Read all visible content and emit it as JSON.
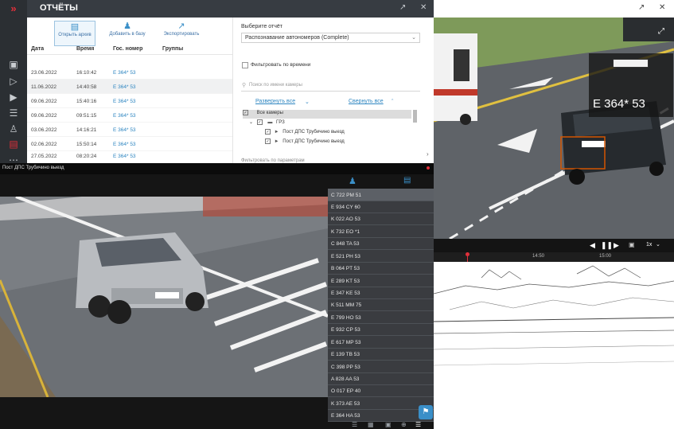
{
  "reports": {
    "title": "ОТЧЁТЫ",
    "toolbar": {
      "open_archive": "Открыть архив",
      "add_to_base": "Добавить в базу",
      "export": "Экспортировать"
    },
    "columns": [
      "Дата",
      "Время",
      "Гос. номер",
      "Группы"
    ],
    "rows": [
      {
        "date": "23.06.2022",
        "time": "16:10:42",
        "plate": "E 364* 53"
      },
      {
        "date": "11.06.2022",
        "time": "14:40:58",
        "plate": "E 364* 53"
      },
      {
        "date": "09.06.2022",
        "time": "15:40:16",
        "plate": "E 364* 53"
      },
      {
        "date": "09.06.2022",
        "time": "09:51:15",
        "plate": "E 364* 53"
      },
      {
        "date": "03.06.2022",
        "time": "14:16:21",
        "plate": "E 364* 53"
      },
      {
        "date": "02.06.2022",
        "time": "15:50:14",
        "plate": "E 364* 53"
      },
      {
        "date": "27.05.2022",
        "time": "08:20:24",
        "plate": "E 364* 53"
      }
    ],
    "select_report_label": "Выберите отчёт",
    "selected_report": "Распознавание автономеров (Complete)",
    "filter_time_label": "Фильтровать по времени",
    "camera_search_placeholder": "Поиск по имени камеры",
    "expand_all": "Развернуть все",
    "collapse_all": "Свернуть все",
    "tree": {
      "all_cameras": "Все камеры",
      "group": "ГРЗ",
      "cam1": "Пост ДПС Трубичино выезд",
      "cam2": "Пост ДПС Трубичино выезд"
    },
    "filter_params": "Фильтровать по параметрам"
  },
  "camera": {
    "name": "Пост ДПС Трубичино выезд",
    "plates": [
      "C 722 PM 51",
      "E 934 CY 60",
      "K 022 AO 53",
      "K 732 EO *1",
      "C 848 TA 53",
      "E 521 PH 53",
      "B 064 PT 53",
      "E 289 KT 53",
      "E 347 KE 53",
      "K 511 MM 75",
      "E 799 HO 53",
      "E 932 CP 53",
      "E 617 MP 53",
      "E 139 TB 53",
      "C 398 PP 53",
      "A 828 AA 53",
      "O 017 EP 40",
      "K 373 AE 53",
      "E 364 HA 53"
    ]
  },
  "right_view": {
    "plate_text": "E 364* 53",
    "time_ticks": [
      "14:50",
      "15:00"
    ],
    "speed": "1x"
  },
  "colors": {
    "accent_red": "#e0303a",
    "link_blue": "#2e86c1",
    "plate_box": "#d35400"
  }
}
